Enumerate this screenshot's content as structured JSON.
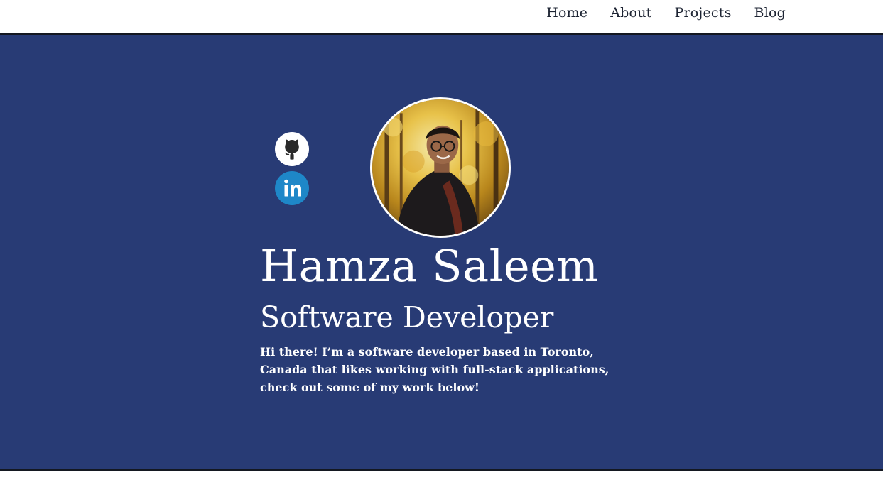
{
  "nav": {
    "items": [
      {
        "label": "Home"
      },
      {
        "label": "About"
      },
      {
        "label": "Projects"
      },
      {
        "label": "Blog"
      }
    ]
  },
  "hero": {
    "name": "Hamza Saleem",
    "role": "Software Developer",
    "bio": "Hi there! I’m a software developer based in Toronto, Canada that likes working with full-stack applications, check out some of my work below!",
    "social": [
      {
        "icon": "github-icon"
      },
      {
        "icon": "linkedin-icon"
      }
    ]
  },
  "colors": {
    "hero_background": "#283b75",
    "nav_background": "#ffffff",
    "rule": "#141821",
    "linkedin": "#1e87c8",
    "github_circle": "#ffffff"
  }
}
